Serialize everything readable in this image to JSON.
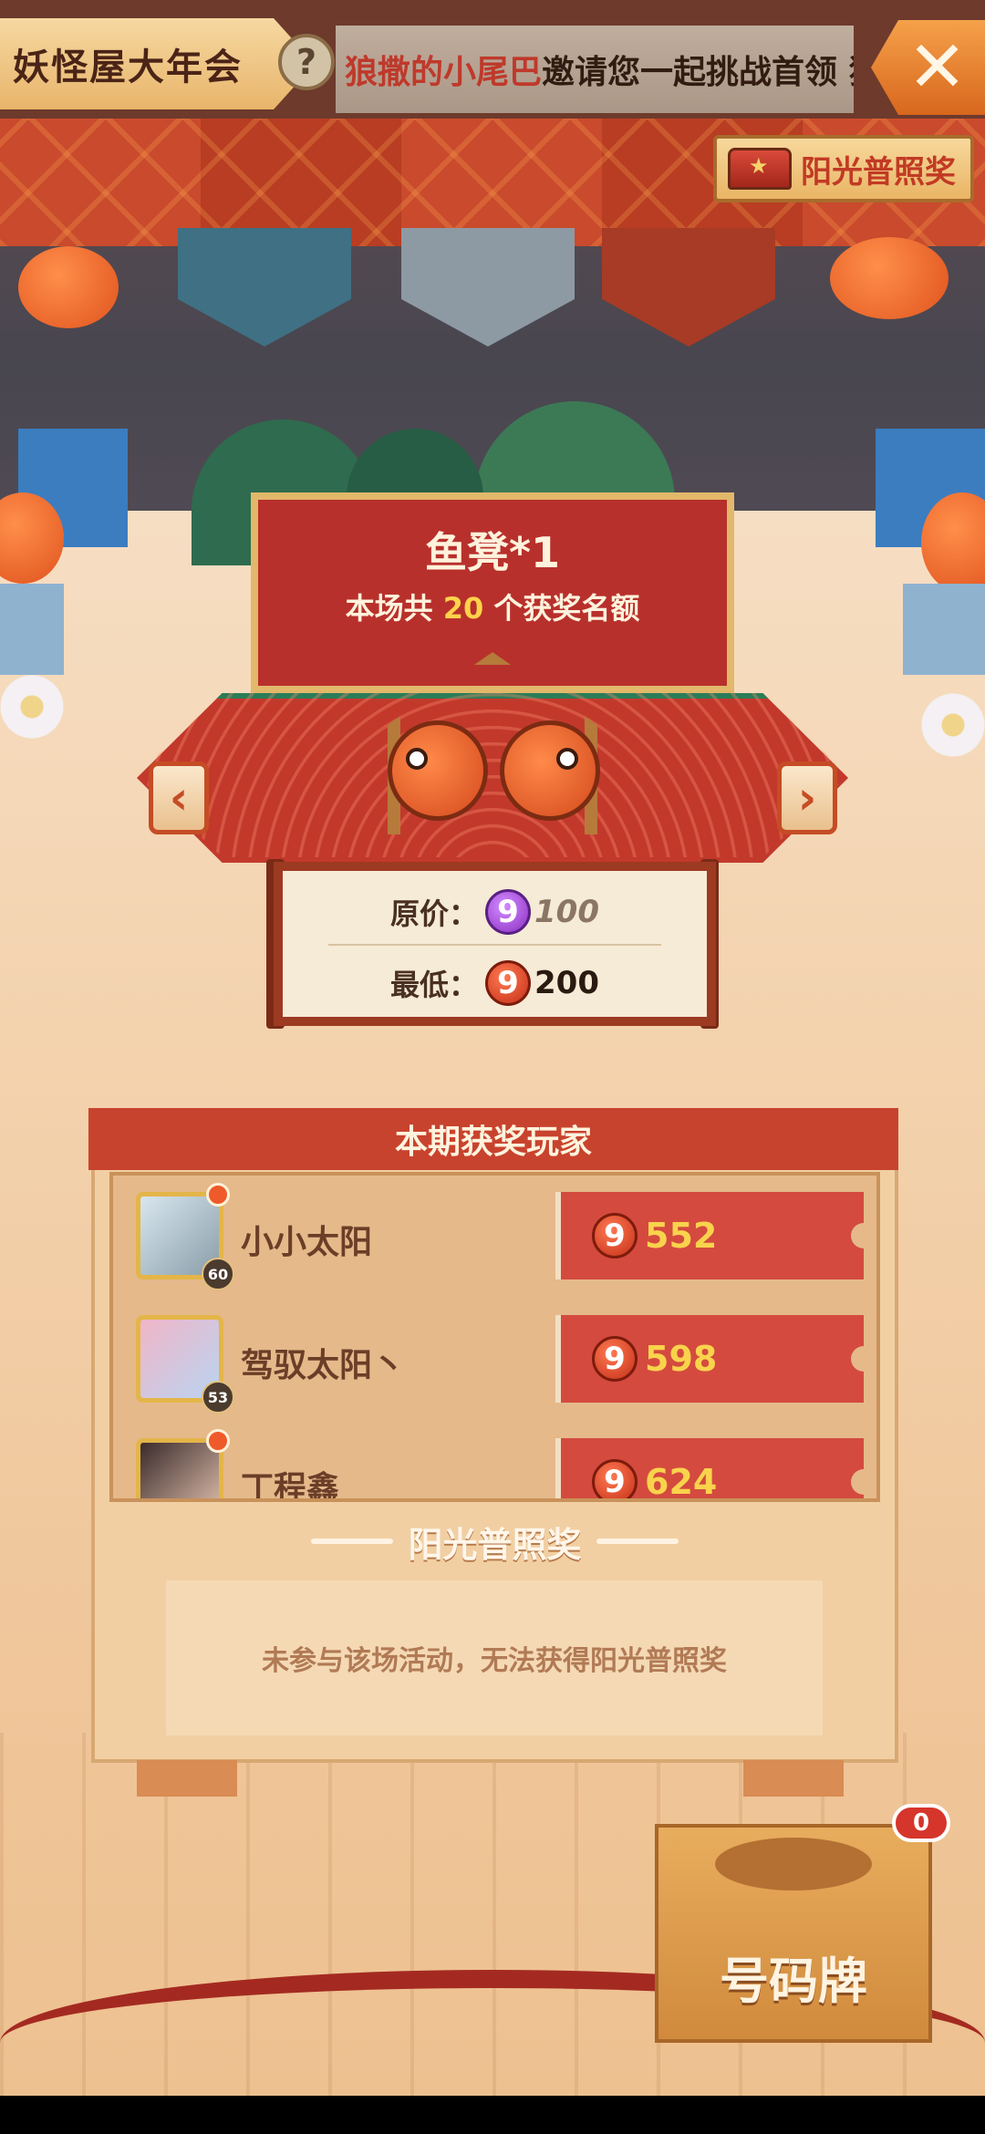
{
  "header": {
    "title": "妖怪屋大年会",
    "help_symbol": "?",
    "close_symbol": "✕"
  },
  "marquee": {
    "user": "狼撒的小尾巴",
    "text": "邀请您一起挑战首领",
    "tail": "猫"
  },
  "sunshine_button": {
    "label": "阳光普照奖",
    "icon": "chest-icon"
  },
  "prize": {
    "name": "鱼凳*1",
    "count_prefix": "本场共",
    "count": "20",
    "count_suffix": "个获奖名额",
    "prev_symbol": "‹",
    "next_symbol": "›"
  },
  "price": {
    "original_label": "原价：",
    "original_value": "100",
    "min_label": "最低：",
    "min_value": "200",
    "coin_symbol": "9"
  },
  "winners": {
    "title": "本期获奖玩家",
    "rows": [
      {
        "name": "小小太阳",
        "level": "60",
        "score": "552"
      },
      {
        "name": "驾驭太阳丶",
        "level": "53",
        "score": "598"
      },
      {
        "name": "丁程鑫",
        "level": "",
        "score": "624"
      }
    ]
  },
  "sunshine_award": {
    "title": "阳光普照奖",
    "message": "未参与该场活动，无法获得阳光普照奖"
  },
  "number_tag": {
    "label": "号码牌",
    "badge": "0"
  },
  "colors": {
    "accent_red": "#c8432e",
    "gold": "#f9d34c",
    "brown": "#6b3e28"
  }
}
